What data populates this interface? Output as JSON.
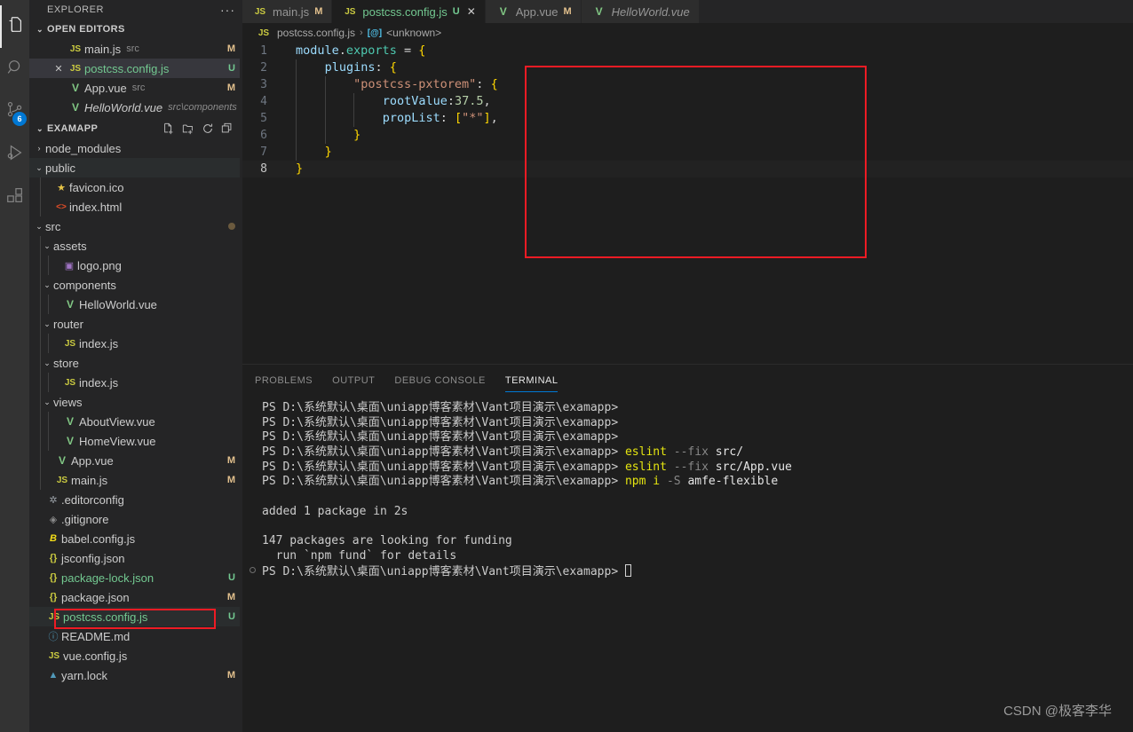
{
  "activity_bar": {
    "items": [
      {
        "name": "explorer",
        "icon": "files-icon",
        "active": true,
        "badge": null
      },
      {
        "name": "search",
        "icon": "search-icon",
        "active": false,
        "badge": null
      },
      {
        "name": "source-control",
        "icon": "source-control-icon",
        "active": false,
        "badge": "6"
      },
      {
        "name": "run-and-debug",
        "icon": "run-debug-icon",
        "active": false,
        "badge": null
      },
      {
        "name": "extensions",
        "icon": "extensions-icon",
        "active": false,
        "badge": null
      }
    ]
  },
  "sidebar": {
    "title": "EXPLORER",
    "more_actions_label": "···",
    "open_editors": {
      "label": "OPEN EDITORS",
      "twisty": "⌄",
      "items": [
        {
          "close": "",
          "icon": "js-icon",
          "name": "main.js",
          "desc": "src",
          "badge": "M",
          "selected": false,
          "italic": false,
          "green": false
        },
        {
          "close": "✕",
          "icon": "js-icon",
          "name": "postcss.config.js",
          "desc": "",
          "badge": "U",
          "selected": true,
          "italic": false,
          "green": true
        },
        {
          "close": "",
          "icon": "vue-icon",
          "name": "App.vue",
          "desc": "src",
          "badge": "M",
          "selected": false,
          "italic": false,
          "green": false
        },
        {
          "close": "",
          "icon": "vue-icon",
          "name": "HelloWorld.vue",
          "desc": "src\\components",
          "badge": "",
          "selected": false,
          "italic": true,
          "green": false
        }
      ]
    },
    "project": {
      "label": "EXAMAPP",
      "twisty": "⌄",
      "actions": [
        {
          "name": "new-file-icon",
          "title": "New File"
        },
        {
          "name": "new-folder-icon",
          "title": "New Folder"
        },
        {
          "name": "refresh-icon",
          "title": "Refresh Explorer"
        },
        {
          "name": "collapse-all-icon",
          "title": "Collapse Folders"
        }
      ]
    },
    "tree": [
      {
        "depth": 0,
        "twisty": "›",
        "icon": "",
        "name": "node_modules",
        "badge": "",
        "green": false,
        "dot": false
      },
      {
        "depth": 0,
        "twisty": "⌄",
        "icon": "",
        "name": "public",
        "badge": "",
        "green": false,
        "dot": false,
        "highlight": true
      },
      {
        "depth": 1,
        "twisty": "",
        "icon": "star-icon",
        "name": "favicon.ico",
        "badge": "",
        "green": false,
        "dot": false
      },
      {
        "depth": 1,
        "twisty": "",
        "icon": "html-icon",
        "name": "index.html",
        "badge": "",
        "green": false,
        "dot": false
      },
      {
        "depth": 0,
        "twisty": "⌄",
        "icon": "",
        "name": "src",
        "badge": "",
        "green": false,
        "dot": true
      },
      {
        "depth": 1,
        "twisty": "⌄",
        "icon": "",
        "name": "assets",
        "badge": "",
        "green": false,
        "dot": false
      },
      {
        "depth": 2,
        "twisty": "",
        "icon": "image-icon",
        "name": "logo.png",
        "badge": "",
        "green": false,
        "dot": false
      },
      {
        "depth": 1,
        "twisty": "⌄",
        "icon": "",
        "name": "components",
        "badge": "",
        "green": false,
        "dot": false
      },
      {
        "depth": 2,
        "twisty": "",
        "icon": "vue-icon",
        "name": "HelloWorld.vue",
        "badge": "",
        "green": false,
        "dot": false
      },
      {
        "depth": 1,
        "twisty": "⌄",
        "icon": "",
        "name": "router",
        "badge": "",
        "green": false,
        "dot": false
      },
      {
        "depth": 2,
        "twisty": "",
        "icon": "js-icon",
        "name": "index.js",
        "badge": "",
        "green": false,
        "dot": false
      },
      {
        "depth": 1,
        "twisty": "⌄",
        "icon": "",
        "name": "store",
        "badge": "",
        "green": false,
        "dot": false
      },
      {
        "depth": 2,
        "twisty": "",
        "icon": "js-icon",
        "name": "index.js",
        "badge": "",
        "green": false,
        "dot": false
      },
      {
        "depth": 1,
        "twisty": "⌄",
        "icon": "",
        "name": "views",
        "badge": "",
        "green": false,
        "dot": false
      },
      {
        "depth": 2,
        "twisty": "",
        "icon": "vue-icon",
        "name": "AboutView.vue",
        "badge": "",
        "green": false,
        "dot": false
      },
      {
        "depth": 2,
        "twisty": "",
        "icon": "vue-icon",
        "name": "HomeView.vue",
        "badge": "",
        "green": false,
        "dot": false
      },
      {
        "depth": 1,
        "twisty": "",
        "icon": "vue-icon",
        "name": "App.vue",
        "badge": "M",
        "green": false,
        "dot": false
      },
      {
        "depth": 1,
        "twisty": "",
        "icon": "js-icon",
        "name": "main.js",
        "badge": "M",
        "green": false,
        "dot": false
      },
      {
        "depth": 0,
        "twisty": "",
        "icon": "gear-icon",
        "name": ".editorconfig",
        "badge": "",
        "green": false,
        "dot": false
      },
      {
        "depth": 0,
        "twisty": "",
        "icon": "git-icon",
        "name": ".gitignore",
        "badge": "",
        "green": false,
        "dot": false
      },
      {
        "depth": 0,
        "twisty": "",
        "icon": "babel-icon",
        "name": "babel.config.js",
        "badge": "",
        "green": false,
        "dot": false
      },
      {
        "depth": 0,
        "twisty": "",
        "icon": "json-icon",
        "name": "jsconfig.json",
        "badge": "",
        "green": false,
        "dot": false
      },
      {
        "depth": 0,
        "twisty": "",
        "icon": "json-icon",
        "name": "package-lock.json",
        "badge": "U",
        "green": true,
        "dot": false
      },
      {
        "depth": 0,
        "twisty": "",
        "icon": "json-icon",
        "name": "package.json",
        "badge": "M",
        "green": false,
        "dot": false
      },
      {
        "depth": 0,
        "twisty": "",
        "icon": "js-icon",
        "name": "postcss.config.js",
        "badge": "U",
        "green": true,
        "dot": false,
        "highlight": true,
        "boxed": true
      },
      {
        "depth": 0,
        "twisty": "",
        "icon": "info-icon",
        "name": "README.md",
        "badge": "",
        "green": false,
        "dot": false
      },
      {
        "depth": 0,
        "twisty": "",
        "icon": "js-icon",
        "name": "vue.config.js",
        "badge": "",
        "green": false,
        "dot": false
      },
      {
        "depth": 0,
        "twisty": "",
        "icon": "yarn-icon",
        "name": "yarn.lock",
        "badge": "M",
        "green": false,
        "dot": false
      }
    ]
  },
  "editor": {
    "tabs": [
      {
        "icon": "js-icon",
        "label": "main.js",
        "badge": "M",
        "badge_color": "#e2c08d",
        "active": false,
        "closable": false,
        "italic": false,
        "green": false
      },
      {
        "icon": "js-icon",
        "label": "postcss.config.js",
        "badge": "U",
        "badge_color": "#73c991",
        "active": true,
        "closable": true,
        "italic": false,
        "green": true,
        "close": "✕"
      },
      {
        "icon": "vue-icon",
        "label": "App.vue",
        "badge": "M",
        "badge_color": "#e2c08d",
        "active": false,
        "closable": false,
        "italic": false,
        "green": false
      },
      {
        "icon": "vue-icon",
        "label": "HelloWorld.vue",
        "badge": "",
        "badge_color": "#e2c08d",
        "active": false,
        "closable": false,
        "italic": true,
        "green": false
      }
    ],
    "breadcrumb": {
      "file_icon": "js-icon",
      "file": "postcss.config.js",
      "separator": "›",
      "symbol_icon": "module-symbol-icon",
      "symbol": "<unknown>"
    },
    "lines": [
      {
        "n": "1",
        "text": "module.exports = {"
      },
      {
        "n": "2",
        "text": "    plugins: {"
      },
      {
        "n": "3",
        "text": "        \"postcss-pxtorem\": {"
      },
      {
        "n": "4",
        "text": "            rootValue:37.5,"
      },
      {
        "n": "5",
        "text": "            propList: [\"*\"],"
      },
      {
        "n": "6",
        "text": "        }"
      },
      {
        "n": "7",
        "text": "    }"
      },
      {
        "n": "8",
        "text": "}"
      }
    ],
    "active_line": 8,
    "highlight_color": "#ee1b24"
  },
  "panel": {
    "tabs": [
      {
        "label": "PROBLEMS",
        "active": false
      },
      {
        "label": "OUTPUT",
        "active": false
      },
      {
        "label": "DEBUG CONSOLE",
        "active": false
      },
      {
        "label": "TERMINAL",
        "active": true
      }
    ],
    "terminal_lines": [
      {
        "type": "prompt",
        "prompt": "PS D:\\系统默认\\桌面\\uniapp博客素材\\Vant项目演示\\examapp>",
        "cmd": "",
        "flag": "",
        "arg": "",
        "gutter": false
      },
      {
        "type": "prompt",
        "prompt": "PS D:\\系统默认\\桌面\\uniapp博客素材\\Vant项目演示\\examapp>",
        "cmd": "",
        "flag": "",
        "arg": "",
        "gutter": false
      },
      {
        "type": "prompt",
        "prompt": "PS D:\\系统默认\\桌面\\uniapp博客素材\\Vant项目演示\\examapp>",
        "cmd": "",
        "flag": "",
        "arg": "",
        "gutter": false
      },
      {
        "type": "prompt",
        "prompt": "PS D:\\系统默认\\桌面\\uniapp博客素材\\Vant项目演示\\examapp>",
        "cmd": "eslint",
        "flag": "--fix",
        "arg": "src/",
        "gutter": false
      },
      {
        "type": "prompt",
        "prompt": "PS D:\\系统默认\\桌面\\uniapp博客素材\\Vant项目演示\\examapp>",
        "cmd": "eslint",
        "flag": "--fix",
        "arg": "src/App.vue",
        "gutter": false
      },
      {
        "type": "prompt",
        "prompt": "PS D:\\系统默认\\桌面\\uniapp博客素材\\Vant项目演示\\examapp>",
        "cmd": "npm i",
        "flag": "-S",
        "arg": "amfe-flexible",
        "gutter": false
      },
      {
        "type": "blank",
        "text": ""
      },
      {
        "type": "out",
        "text": "added 1 package in 2s"
      },
      {
        "type": "blank",
        "text": ""
      },
      {
        "type": "out",
        "text": "147 packages are looking for funding"
      },
      {
        "type": "out",
        "text": "  run `npm fund` for details"
      },
      {
        "type": "prompt",
        "prompt": "PS D:\\系统默认\\桌面\\uniapp博客素材\\Vant项目演示\\examapp>",
        "cmd": "",
        "flag": "",
        "arg": "",
        "gutter": true,
        "cursor": true
      }
    ]
  },
  "watermark": "CSDN @极客李华"
}
